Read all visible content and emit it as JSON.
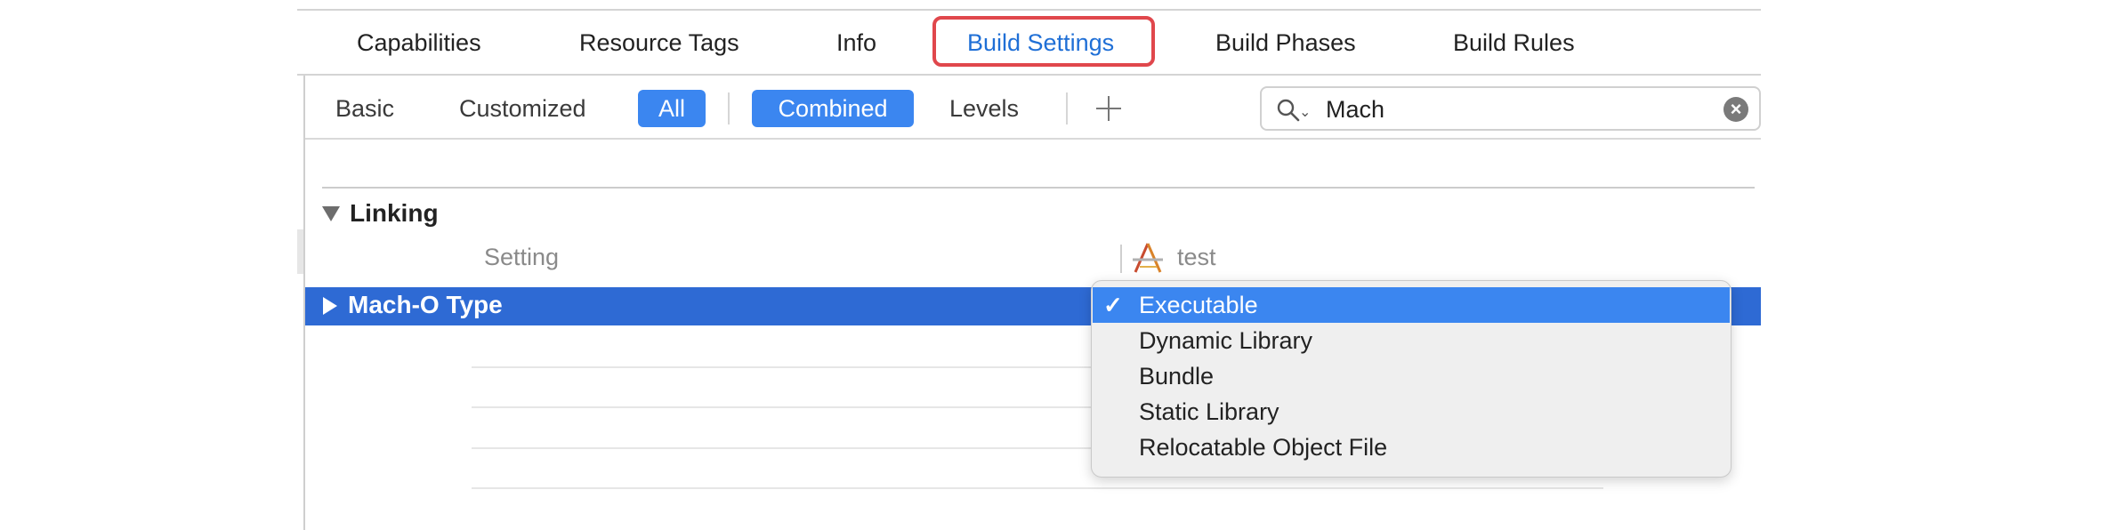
{
  "tabs": [
    {
      "label": "Capabilities"
    },
    {
      "label": "Resource Tags"
    },
    {
      "label": "Info"
    },
    {
      "label": "Build Settings",
      "active": true
    },
    {
      "label": "Build Phases"
    },
    {
      "label": "Build Rules"
    }
  ],
  "filters": {
    "basic": "Basic",
    "customized": "Customized",
    "all": "All",
    "combined": "Combined",
    "levels": "Levels"
  },
  "search": {
    "value": "Mach",
    "icon": "magnifying-glass-icon",
    "clear_icon": "clear-x-icon"
  },
  "section": {
    "title": "Linking",
    "col_setting": "Setting",
    "col_target": "test",
    "target_icon": "app-target-icon"
  },
  "row": {
    "label": "Mach-O Type"
  },
  "menu": {
    "items": [
      {
        "label": "Executable",
        "checked": true
      },
      {
        "label": "Dynamic Library"
      },
      {
        "label": "Bundle"
      },
      {
        "label": "Static Library"
      },
      {
        "label": "Relocatable Object File"
      }
    ],
    "checkmark": "✓"
  },
  "colors": {
    "accent": "#3b86f0",
    "selection": "#2e6ad4",
    "highlight_box": "#e0474c"
  }
}
